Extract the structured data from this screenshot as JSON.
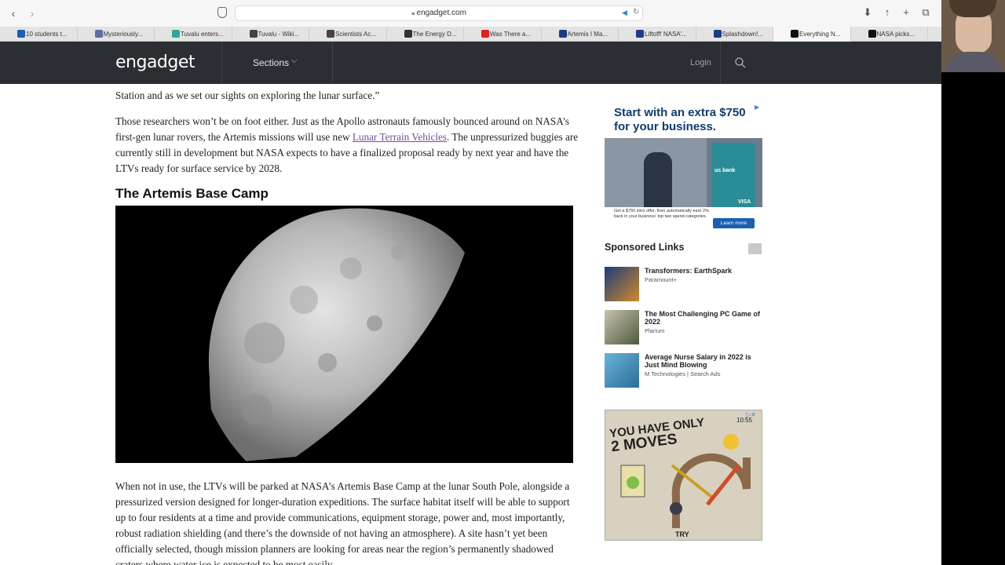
{
  "browser": {
    "url": "engadget.com",
    "tabs": [
      {
        "label": "10 students t...",
        "color": "#1a5fb4",
        "active": false
      },
      {
        "label": "Mysteriously...",
        "color": "#5b6ea8",
        "active": false
      },
      {
        "label": "Tuvalu enters...",
        "color": "#2fa7a0",
        "active": false
      },
      {
        "label": "Tuvalu - Wiki...",
        "color": "#444444",
        "active": false
      },
      {
        "label": "Scientists Ac...",
        "color": "#444444",
        "active": false
      },
      {
        "label": "The Energy D...",
        "color": "#333333",
        "active": false
      },
      {
        "label": "Was There a...",
        "color": "#e02020",
        "active": false
      },
      {
        "label": "Artemis I Ma...",
        "color": "#1e3b8a",
        "active": false
      },
      {
        "label": "Liftoff! NASA'...",
        "color": "#1e3b8a",
        "active": false
      },
      {
        "label": "Splashdown!...",
        "color": "#1e3b8a",
        "active": false
      },
      {
        "label": "Everything N...",
        "color": "#111111",
        "active": true
      },
      {
        "label": "NASA picks...",
        "color": "#111111",
        "active": false
      }
    ]
  },
  "site": {
    "logo": "engadget",
    "sections_label": "Sections",
    "login_label": "Login"
  },
  "article": {
    "para0": "Station and as we set our sights on exploring the lunar surface.”",
    "para1_before": "Those researchers won’t be on foot either. Just as the Apollo astronauts famously bounced around on NASA’s first-gen lunar rovers, the Artemis missions will use new ",
    "para1_link": "Lunar Terrain Vehicles",
    "para1_after": ". The unpressurized buggies are currently still in development but NASA expects to have a finalized proposal ready by next year and have the LTVs ready for surface service by 2028.",
    "heading": "The Artemis Base Camp",
    "para2": "When not in use, the LTVs will be parked at NASA’s Artemis Base Camp at the lunar South Pole, alongside a pressurized version designed for longer-duration expeditions. The surface habitat itself will be able to support up to four residents at a time and provide communications, equipment storage, power and, most importantly, robust radiation shielding (and there’s the downside of not having an atmosphere). A site hasn’t yet been officially selected, though mission planners are looking for areas near the region’s permanently shadowed craters where water ice is expected to be most easily"
  },
  "sidebar": {
    "ad1_title": "Start with an extra $750 for your business.",
    "ad1_fine": "Get a $750 intro offer, then automatically earn 2% back in your business' top two spend categories.",
    "ad1_button": "Learn more",
    "ad1_card_brand": "us bank",
    "ad1_card_network": "VISA",
    "sponsored_title": "Sponsored Links",
    "sponsored": [
      {
        "headline": "Transformers: EarthSpark",
        "source": "Paramount+"
      },
      {
        "headline": "The Most Challenging PC Game of 2022",
        "source": "Plarium"
      },
      {
        "headline": "Average Nurse Salary in 2022 is Just Mind Blowing",
        "source": "M Technologies | Search Ads"
      }
    ],
    "ad2_headline_1": "YOU HAVE ONLY",
    "ad2_headline_2": "2 MOVES",
    "ad2_timer": "10:55",
    "ad2_cta": "TRY"
  }
}
